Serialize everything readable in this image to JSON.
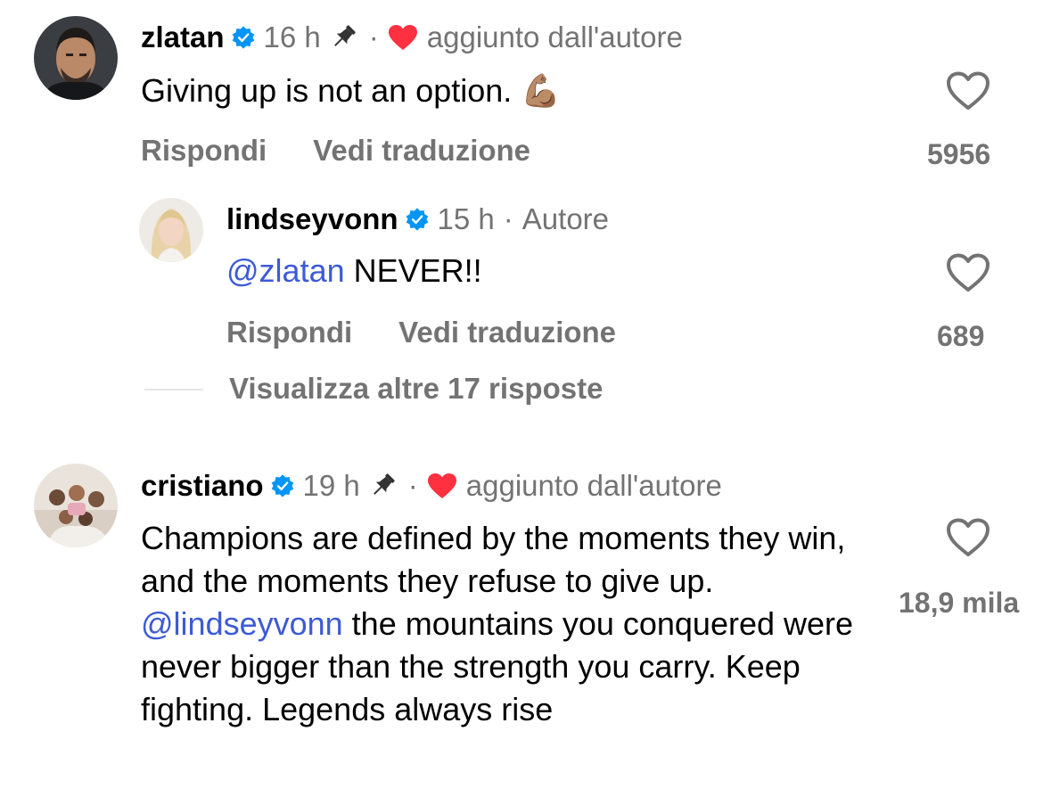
{
  "comments": [
    {
      "username": "zlatan",
      "time": "16 h",
      "loved_label": "aggiunto dall'autore",
      "text": "Giving up is not an option. 💪🏽",
      "reply_label": "Rispondi",
      "translate_label": "Vedi traduzione",
      "likes": "5956"
    },
    {
      "username": "lindseyvonn",
      "time": "15 h",
      "author_label": "Autore",
      "mention": "@zlatan",
      "text": " NEVER!!",
      "reply_label": "Rispondi",
      "translate_label": "Vedi traduzione",
      "likes": "689"
    },
    {
      "username": "cristiano",
      "time": "19 h",
      "loved_label": "aggiunto dall'autore",
      "text_before": "Champions are defined by the moments they win, and the moments they refuse to give up. ",
      "mention": "@lindseyvonn",
      "text_after": " the mountains you conquered were never bigger than the strength you carry. Keep fighting. Legends always rise",
      "likes": "18,9 mila"
    }
  ],
  "view_more_replies": "Visualizza altre 17 risposte",
  "colors": {
    "verified": "#0095f6",
    "heart": "#ff3040",
    "mention": "#3d5ad6",
    "secondary_text": "#737373"
  },
  "icons": [
    "verified-badge-icon",
    "pin-icon",
    "heart-filled-icon",
    "like-heart-icon"
  ]
}
